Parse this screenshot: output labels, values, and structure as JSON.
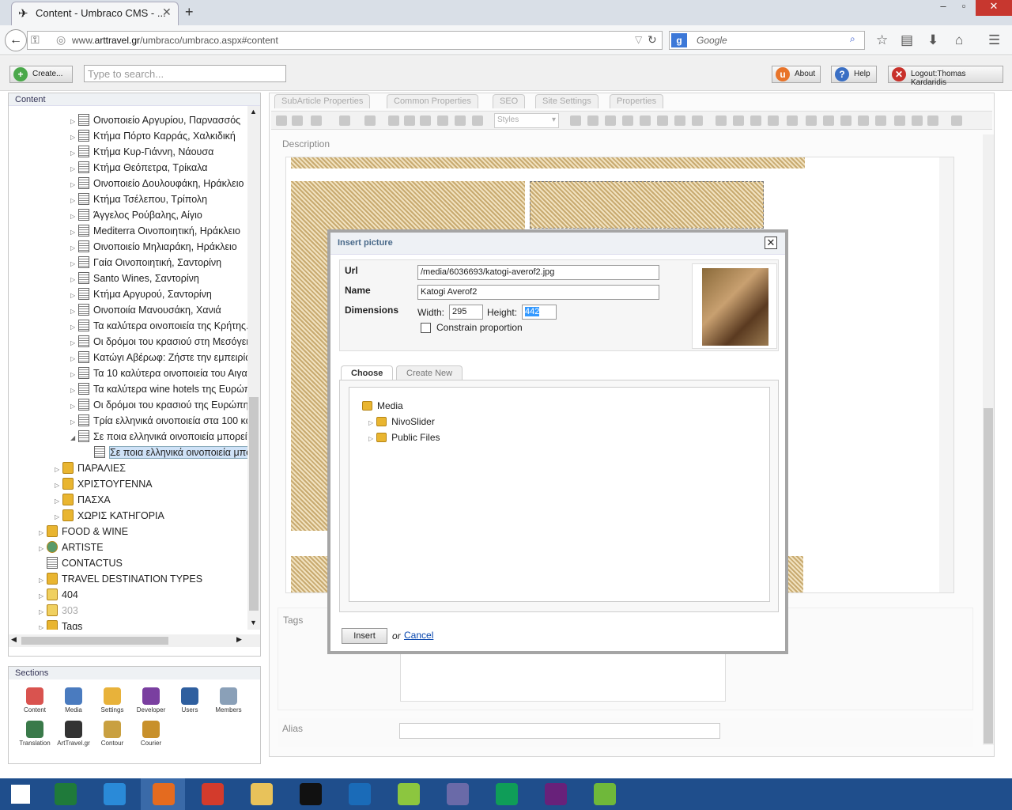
{
  "browser": {
    "tab_title": "Content - Umbraco CMS - ...",
    "url_prefix": "www.",
    "url_domain": "arttravel.gr",
    "url_path": "/umbraco/umbraco.aspx#content",
    "search_placeholder": "Google",
    "window_controls": {
      "minimize": "–",
      "maximize": "▫",
      "close": "✕"
    }
  },
  "umbraco": {
    "create_label": "Create...",
    "search_placeholder": "Type to search...",
    "about_label": "About",
    "help_label": "Help",
    "logout_label": "Logout:Thomas Kardaridis"
  },
  "tree": {
    "header": "Content",
    "items": [
      {
        "label": "Οινοποιείο Αργυρίου, Παρνασσός",
        "type": "doc",
        "level": 4
      },
      {
        "label": "Κτήμα Πόρτο Καρράς, Χαλκιδική",
        "type": "doc",
        "level": 4
      },
      {
        "label": "Κτήμα Κυρ-Γιάννη, Νάουσα",
        "type": "doc",
        "level": 4
      },
      {
        "label": "Κτήμα Θεόπετρα, Τρίκαλα",
        "type": "doc",
        "level": 4
      },
      {
        "label": "Οινοποιείο Δουλουφάκη, Ηράκλειο",
        "type": "doc",
        "level": 4
      },
      {
        "label": "Κτήμα Τσέλεπου, Τρίπολη",
        "type": "doc",
        "level": 4
      },
      {
        "label": "Άγγελος Ρούβαλης, Αίγιο",
        "type": "doc",
        "level": 4
      },
      {
        "label": "Mediterra Οινοποιητική, Ηράκλειο",
        "type": "doc",
        "level": 4
      },
      {
        "label": "Οινοποιείο Μηλιαράκη, Ηράκλειο",
        "type": "doc",
        "level": 4
      },
      {
        "label": "Γαία Οινοποιητική, Σαντορίνη",
        "type": "doc",
        "level": 4
      },
      {
        "label": "Santo Wines, Σαντορίνη",
        "type": "doc",
        "level": 4
      },
      {
        "label": "Κτήμα Αργυρού, Σαντορίνη",
        "type": "doc",
        "level": 4
      },
      {
        "label": "Οινοποιία Μανουσάκη, Χανιά",
        "type": "doc",
        "level": 4
      },
      {
        "label": "Τα καλύτερα οινοποιεία της Κρήτης.",
        "type": "doc",
        "level": 4
      },
      {
        "label": "Οι δρόμοι του κρασιού στη Μεσόγει",
        "type": "doc",
        "level": 4
      },
      {
        "label": "Κατώγι Αβέρωφ: Ζήστε την εμπειρία",
        "type": "doc",
        "level": 4
      },
      {
        "label": "Τα 10 καλύτερα οινοποιεία του Αιγαί",
        "type": "doc",
        "level": 4
      },
      {
        "label": "Τα καλύτερα wine hotels της Ευρώπ",
        "type": "doc",
        "level": 4
      },
      {
        "label": "Οι δρόμοι του κρασιού της Ευρώπη",
        "type": "doc",
        "level": 4
      },
      {
        "label": "Τρία ελληνικά οινοποιεία στα 100 κα",
        "type": "doc",
        "level": 4
      },
      {
        "label": "Σε ποια ελληνικά οινοποιεία μπορείτ",
        "type": "doc",
        "level": 4,
        "expanded": true
      },
      {
        "label": "Σε ποια ελληνικά οινοποιεία μπο",
        "type": "doc",
        "level": 5,
        "selected": true
      },
      {
        "label": "ΠΑΡΑΛΙΕΣ",
        "type": "folder",
        "level": 3
      },
      {
        "label": "ΧΡΙΣΤΟΥΓΕΝΝΑ",
        "type": "folder",
        "level": 3
      },
      {
        "label": "ΠΑΣΧΑ",
        "type": "folder",
        "level": 3
      },
      {
        "label": "ΧΩΡΙΣ ΚΑΤΗΓΟΡΙΑ",
        "type": "folder",
        "level": 3
      },
      {
        "label": "FOOD & WINE",
        "type": "folder",
        "level": 2
      },
      {
        "label": "ARTISTE",
        "type": "globe",
        "level": 2
      },
      {
        "label": "CONTACTUS",
        "type": "page",
        "level": 2
      },
      {
        "label": "TRAVEL DESTINATION TYPES",
        "type": "folder",
        "level": 2
      },
      {
        "label": "404",
        "type": "warn",
        "level": 2
      },
      {
        "label": "303",
        "type": "warn",
        "level": 2,
        "dimmed": true
      },
      {
        "label": "Tags",
        "type": "folder",
        "level": 2
      }
    ]
  },
  "sections": {
    "header": "Sections",
    "items": [
      {
        "label": "Content",
        "color": "#d9534f"
      },
      {
        "label": "Media",
        "color": "#4a7bbf"
      },
      {
        "label": "Settings",
        "color": "#e8b23a"
      },
      {
        "label": "Developer",
        "color": "#7a3fa0"
      },
      {
        "label": "Users",
        "color": "#2f5f9f"
      },
      {
        "label": "Members",
        "color": "#8aa0b8"
      },
      {
        "label": "Translation",
        "color": "#3a7a4a"
      },
      {
        "label": "ArtTravel.gr",
        "color": "#333333"
      },
      {
        "label": "Contour",
        "color": "#c9a040"
      },
      {
        "label": "Courier",
        "color": "#c8902a"
      }
    ]
  },
  "editor": {
    "tabs": [
      "SubArticle Properties",
      "Common Properties",
      "SEO",
      "Site Settings",
      "Properties"
    ],
    "styles_label": "Styles",
    "description_label": "Description",
    "tags_label": "Tags",
    "alias_label": "Alias"
  },
  "dialog": {
    "title": "Insert picture",
    "url_label": "Url",
    "url_value": "/media/6036693/katogi-averof2.jpg",
    "name_label": "Name",
    "name_value": "Katogi Averof2",
    "dimensions_label": "Dimensions",
    "width_label": "Width:",
    "width_value": "295",
    "height_label": "Height:",
    "height_value": "442",
    "constrain_label": "Constrain proportion",
    "tabs": [
      "Choose",
      "Create New"
    ],
    "media_root": "Media",
    "media_children": [
      "NivoSlider",
      "Public Files"
    ],
    "insert_label": "Insert",
    "or_label": "or",
    "cancel_label": "Cancel"
  },
  "taskbar": {
    "apps": [
      {
        "name": "start",
        "color": "#ffffff"
      },
      {
        "name": "excel",
        "color": "#1f7a3a"
      },
      {
        "name": "internet-explorer",
        "color": "#2a8ad8"
      },
      {
        "name": "firefox",
        "color": "#e46b1f"
      },
      {
        "name": "chrome",
        "color": "#d33b2c"
      },
      {
        "name": "file-explorer",
        "color": "#e8c25a"
      },
      {
        "name": "command-prompt",
        "color": "#111111"
      },
      {
        "name": "outlook",
        "color": "#1a6bb8"
      },
      {
        "name": "notepad-plus-plus",
        "color": "#8cc63f"
      },
      {
        "name": "visual-studio-tool",
        "color": "#6a6aa8"
      },
      {
        "name": "hangouts",
        "color": "#0f9d58"
      },
      {
        "name": "visual-studio",
        "color": "#68217a"
      },
      {
        "name": "camtasia",
        "color": "#6fb83a"
      }
    ]
  }
}
